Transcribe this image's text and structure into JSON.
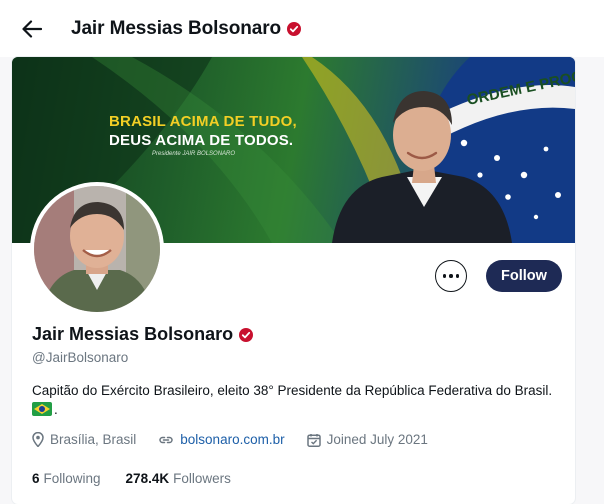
{
  "header": {
    "title": "Jair Messias Bolsonaro",
    "back_icon": "arrow-left-icon"
  },
  "banner": {
    "line1": "BRASIL ACIMA DE TUDO,",
    "line2": "DEUS ACIMA DE TODOS.",
    "signature": "Presidente JAIR BOLSONARO",
    "flag_motto": "ORDEM E PROGRESSO"
  },
  "actions": {
    "more_icon": "more-horizontal-icon",
    "follow_label": "Follow"
  },
  "profile": {
    "name": "Jair Messias Bolsonaro",
    "handle": "@JairBolsonaro",
    "bio": "Capitão do Exército Brasileiro, eleito 38° Presidente da República Federativa do Brasil.",
    "bio_suffix": ".",
    "location": "Brasília, Brasil",
    "website": "bolsonaro.com.br",
    "joined": "Joined July 2021"
  },
  "stats": {
    "following_count": "6",
    "following_label": "Following",
    "followers_count": "278.4K",
    "followers_label": "Followers"
  },
  "colors": {
    "follow_button": "#1e2a55",
    "verified_badge": "#c8102e",
    "link": "#1d5fa8",
    "muted_text": "#6b7680"
  }
}
